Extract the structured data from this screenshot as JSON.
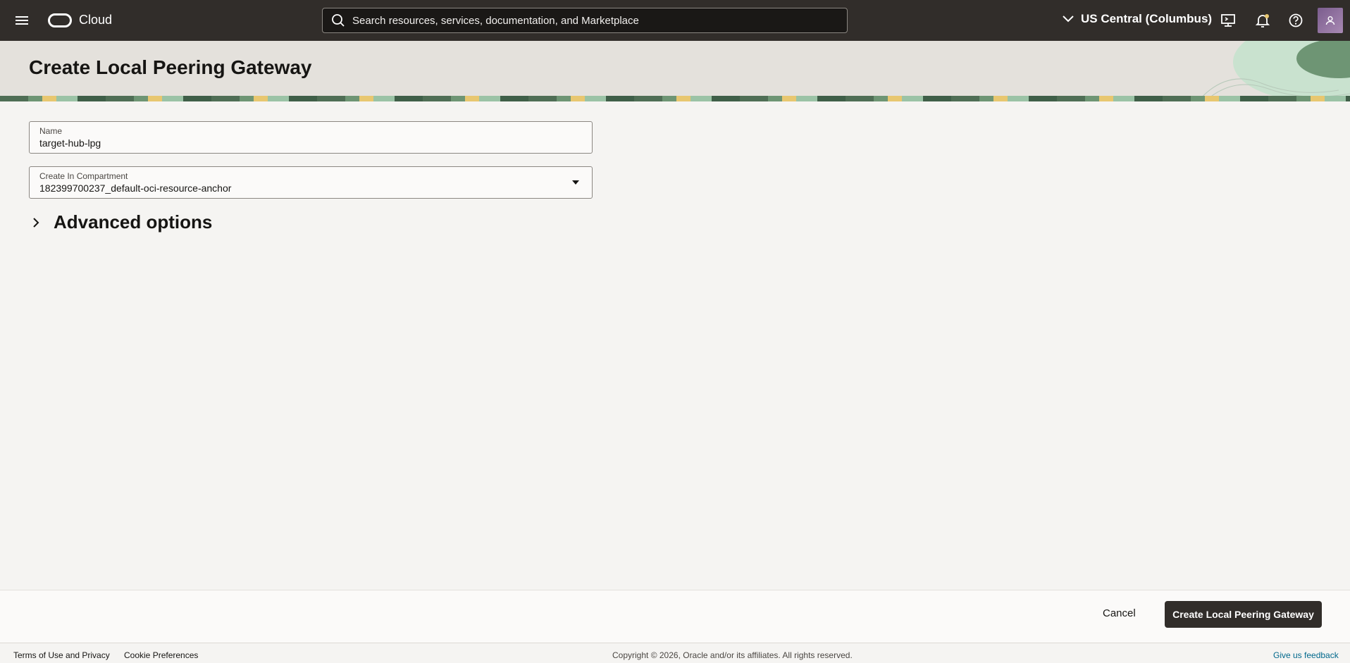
{
  "topbar": {
    "brand": "Cloud",
    "search_placeholder": "Search resources, services, documentation, and Marketplace",
    "region": "US Central (Columbus)"
  },
  "header": {
    "title": "Create Local Peering Gateway"
  },
  "form": {
    "name": {
      "label": "Name",
      "value": "target-hub-lpg"
    },
    "compartment": {
      "label": "Create In Compartment",
      "value": "182399700237_default-oci-resource-anchor"
    },
    "advanced_label": "Advanced options"
  },
  "actions": {
    "cancel": "Cancel",
    "submit": "Create Local Peering Gateway"
  },
  "footer": {
    "terms": "Terms of Use and Privacy",
    "cookies": "Cookie Preferences",
    "copyright": "Copyright © 2026, Oracle and/or its affiliates. All rights reserved.",
    "feedback": "Give us feedback"
  },
  "colors": {
    "topbar": "#312d2a",
    "primary_button": "#312d2a",
    "link": "#00688c"
  }
}
